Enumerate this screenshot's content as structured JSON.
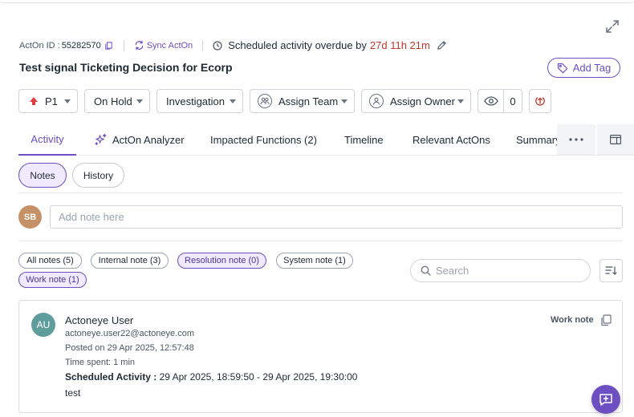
{
  "header": {
    "acton_id_label": "ActOn ID :",
    "acton_id_value": "55282570",
    "sync_label": "Sync ActOn",
    "overdue_text": "Scheduled activity overdue by",
    "overdue_value": "27d 11h 21m",
    "title": "Test signal Ticketing Decision for Ecorp",
    "add_tag_label": "Add Tag"
  },
  "controls": {
    "priority": "P1",
    "status": "On Hold",
    "category": "Investigation",
    "assign_team": "Assign Team",
    "assign_owner": "Assign Owner",
    "watchers_count": "0"
  },
  "tabs": [
    {
      "label": "Activity",
      "active": true
    },
    {
      "label": "ActOn Analyzer",
      "icon": "sparkle-icon"
    },
    {
      "label": "Impacted Functions (2)"
    },
    {
      "label": "Timeline"
    },
    {
      "label": "Relevant ActOns"
    },
    {
      "label": "Summary"
    }
  ],
  "subtabs": {
    "notes": "Notes",
    "history": "History"
  },
  "note_input": {
    "avatar_initials": "SB",
    "placeholder": "Add note here"
  },
  "filters": {
    "all": "All notes (5)",
    "internal": "Internal note (3)",
    "resolution": "Resolution note (0)",
    "system": "System note (1)",
    "work": "Work note (1)",
    "search_placeholder": "Search"
  },
  "note": {
    "avatar_initials": "AU",
    "author": "Actoneye User",
    "email": "actoneye.user22@actoneye.com",
    "posted": "Posted on 29 Apr 2025, 12:57:48",
    "time_spent": "Time spent: 1 min",
    "scheduled_label": "Scheduled Activity :",
    "scheduled_value": " 29 Apr 2025, 18:59:50 - 29 Apr 2025, 19:30:00",
    "body": "test",
    "type": "Work note"
  },
  "colors": {
    "accent": "#6d4fc2",
    "overdue": "#c0392b",
    "priority": "#e23d3d"
  }
}
